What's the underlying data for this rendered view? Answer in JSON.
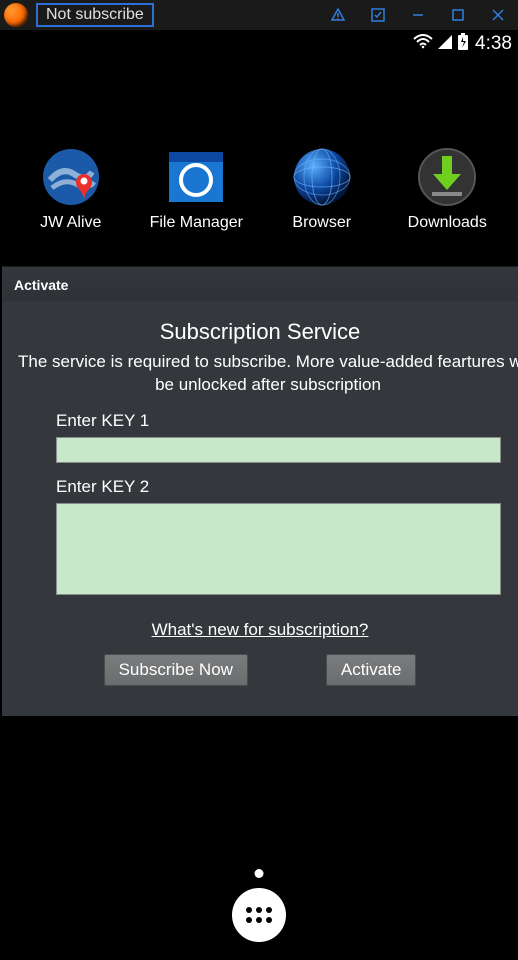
{
  "titlebar": {
    "title": "Not subscribe"
  },
  "statusbar": {
    "time": "4:38"
  },
  "apps": [
    {
      "label": "JW Alive"
    },
    {
      "label": "File Manager"
    },
    {
      "label": "Browser"
    },
    {
      "label": "Downloads"
    }
  ],
  "panel": {
    "tab_label": "Activate",
    "title": "Subscription Service",
    "description_line1": "The service is required to subscribe. More value-added feartures w",
    "description_line2": "be unlocked after subscription",
    "key1_label": "Enter KEY 1",
    "key1_value": "",
    "key2_label": "Enter KEY 2",
    "key2_value": "",
    "whats_new_label": "What's new for subscription?",
    "subscribe_label": "Subscribe Now",
    "activate_label": "Activate"
  }
}
